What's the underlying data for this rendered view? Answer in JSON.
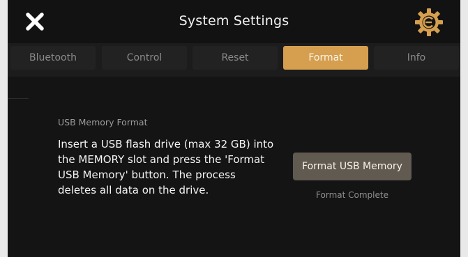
{
  "header": {
    "title": "System Settings",
    "close_icon": "close-icon",
    "logo_icon": "gear-logo-icon",
    "accent_color": "#d59f4f"
  },
  "tabs": [
    {
      "label": "Bluetooth",
      "active": false
    },
    {
      "label": "Control",
      "active": false
    },
    {
      "label": "Reset",
      "active": false
    },
    {
      "label": "Format",
      "active": true
    },
    {
      "label": "Info",
      "active": false
    }
  ],
  "format_panel": {
    "section_label": "USB Memory Format",
    "description": "Insert a USB flash drive (max 32 GB) into the MEMORY slot and press the 'Format USB Memory' button. The process deletes all data on the drive.",
    "button_label": "Format USB Memory",
    "status_text": "Format Complete"
  }
}
